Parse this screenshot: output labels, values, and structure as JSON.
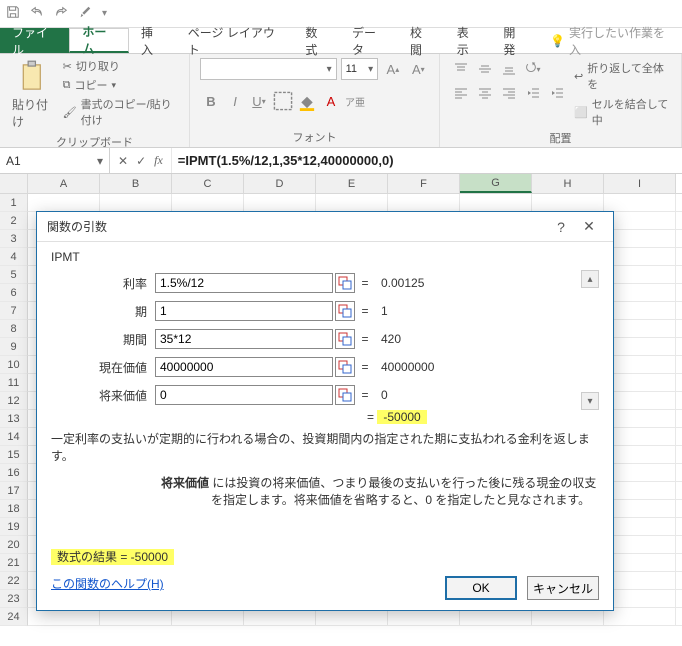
{
  "titlebar": {
    "save_icon": "save",
    "undo_icon": "undo",
    "redo_icon": "redo",
    "customize_icon": "dropdown"
  },
  "tabs": {
    "file": "ファイル",
    "home": "ホーム",
    "insert": "挿入",
    "pagelayout": "ページ レイアウト",
    "formulas": "数式",
    "data": "データ",
    "review": "校閲",
    "view": "表示",
    "developer": "開発",
    "tellme": "実行したい作業を入"
  },
  "ribbon": {
    "paste": "貼り付け",
    "cut": "切り取り",
    "copy": "コピー",
    "formatpainter": "書式のコピー/貼り付け",
    "clipboard_label": "クリップボード",
    "font_placeholder": "",
    "fontsize": "11",
    "font_label": "フォント",
    "wrap": "折り返して全体を",
    "merge": "セルを結合して中",
    "align_label": "配置"
  },
  "fxbar": {
    "name": "A1",
    "cancel": "✕",
    "enter": "✓",
    "fx": "fx",
    "formula": "=IPMT(1.5%/12,1,35*12,40000000,0)"
  },
  "columns": [
    "A",
    "B",
    "C",
    "D",
    "E",
    "F",
    "G",
    "H",
    "I"
  ],
  "selected_col_index": 6,
  "row_count": 24,
  "dialog": {
    "title": "関数の引数",
    "help_symbol": "?",
    "close_symbol": "✕",
    "fn": "IPMT",
    "args": [
      {
        "label": "利率",
        "input": "1.5%/12",
        "val": "0.00125"
      },
      {
        "label": "期",
        "input": "1",
        "val": "1"
      },
      {
        "label": "期間",
        "input": "35*12",
        "val": "420"
      },
      {
        "label": "現在価値",
        "input": "40000000",
        "val": "40000000"
      },
      {
        "label": "将来価値",
        "input": "0|",
        "val": "0"
      }
    ],
    "inline_eq": "=",
    "inline_result": "-50000",
    "desc1": "一定利率の支払いが定期的に行われる場合の、投資期間内の指定された期に支払われる金利を返します。",
    "desc2_label": "将来価値",
    "desc2_text": "には投資の将来価値、つまり最後の支払いを行った後に残る現金の収支を指定します。将来価値を省略すると、0 を指定したと見なされます。",
    "result_label": "数式の結果 =  -50000",
    "help": "この関数のヘルプ(H)",
    "ok": "OK",
    "cancel": "キャンセル"
  }
}
